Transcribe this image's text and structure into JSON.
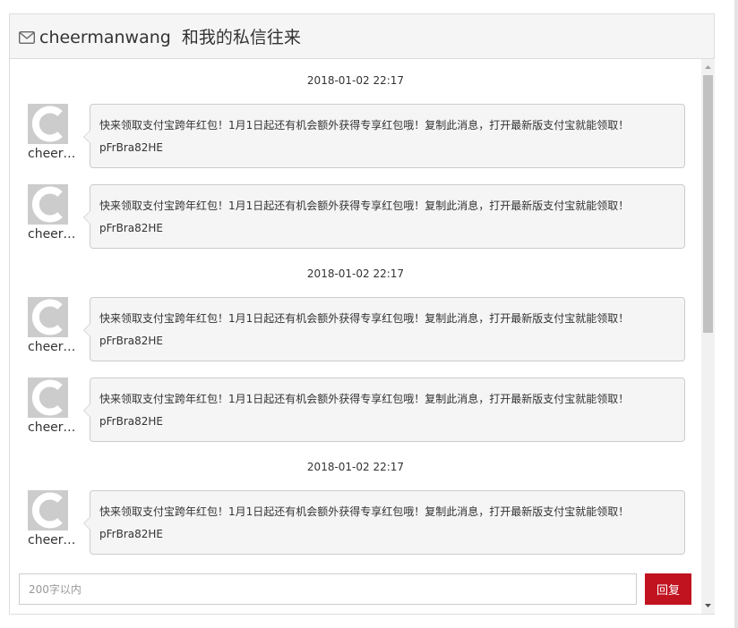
{
  "header": {
    "title": "cheermanwang  和我的私信往来",
    "icon": "envelope-icon"
  },
  "messages": {
    "timestamps": [
      "2018-01-02 22:17",
      "2018-01-02 22:17",
      "2018-01-02 22:17"
    ],
    "items": [
      {
        "sender": "cheermanwang",
        "line1": "快来领取支付宝跨年红包！1月1日起还有机会额外获得专享红包哦！复制此消息，打开最新版支付宝就能领取！",
        "line2": "pFrBra82HE"
      },
      {
        "sender": "cheermanwang",
        "line1": "快来领取支付宝跨年红包！1月1日起还有机会额外获得专享红包哦！复制此消息，打开最新版支付宝就能领取！",
        "line2": "pFrBra82HE"
      },
      {
        "sender": "cheermanwang",
        "line1": "快来领取支付宝跨年红包！1月1日起还有机会额外获得专享红包哦！复制此消息，打开最新版支付宝就能领取！",
        "line2": "pFrBra82HE"
      },
      {
        "sender": "cheermanwang",
        "line1": "快来领取支付宝跨年红包！1月1日起还有机会额外获得专享红包哦！复制此消息，打开最新版支付宝就能领取！",
        "line2": "pFrBra82HE"
      },
      {
        "sender": "cheermanwang",
        "line1": "快来领取支付宝跨年红包！1月1日起还有机会额外获得专享红包哦！复制此消息，打开最新版支付宝就能领取！",
        "line2": "pFrBra82HE"
      }
    ]
  },
  "reply": {
    "placeholder": "200字以内",
    "value": "",
    "button_label": "回复"
  },
  "colors": {
    "accent": "#c1121f",
    "bubble_bg": "#f5f5f5",
    "avatar_bg": "#cccccc"
  }
}
